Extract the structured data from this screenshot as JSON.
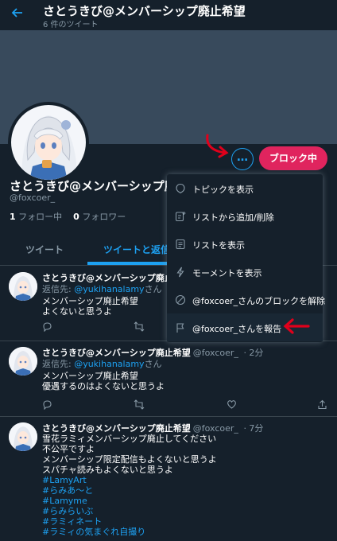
{
  "header": {
    "title": "さとうきび@メンバーシップ廃止希望",
    "subtitle": "6 件のツイート"
  },
  "profile": {
    "name": "さとうきび@メンバーシップ廃止希望",
    "handle": "@foxcoer_",
    "following_count": "1",
    "following_label": "フォロー中",
    "followers_count": "0",
    "followers_label": "フォロワー",
    "blocked_button": "ブロック中",
    "more_button": "…"
  },
  "tabs": [
    "ツイート",
    "ツイートと返信"
  ],
  "menu": [
    {
      "label": "トピックを表示",
      "icon": "topic-icon"
    },
    {
      "label": "リストから追加/削除",
      "icon": "list-add-icon"
    },
    {
      "label": "リストを表示",
      "icon": "list-icon"
    },
    {
      "label": "モーメントを表示",
      "icon": "moment-icon"
    },
    {
      "label": "@foxcoer_さんのブロックを解除",
      "icon": "unblock-icon"
    },
    {
      "label": "@foxcoer_さんを報告",
      "icon": "flag-icon"
    }
  ],
  "tweets": [
    {
      "name": "さとうきび@メンバーシップ廃止",
      "handle": "",
      "time": "",
      "reply_prefix": "返信先: ",
      "reply_to": "@yukihanalamy",
      "reply_suffix": "さん",
      "lines": [
        "メンバーシップ廃止希望",
        "よくないと思うよ"
      ]
    },
    {
      "name": "さとうきび@メンバーシップ廃止希望",
      "handle": "@foxcoer_",
      "time": "· 2分",
      "reply_prefix": "返信先: ",
      "reply_to": "@yukihanalamy",
      "reply_suffix": "さん",
      "lines": [
        "メンバーシップ廃止希望",
        "優遇するのはよくないと思うよ"
      ]
    },
    {
      "name": "さとうきび@メンバーシップ廃止希望",
      "handle": "@foxcoer_",
      "time": "· 7分",
      "lines": [
        "雪花ラミィメンバーシップ廃止してください",
        "不公平ですよ",
        "メンバーシップ限定配信もよくないと思うよ",
        "スパチャ読みもよくないと思うよ"
      ],
      "hashtags": [
        "#LamyArt",
        "#らみあ～と",
        "#Lamyme",
        "#らみらいぶ",
        "#ラミィネート",
        "#ラミィの気まぐれ自撮り"
      ]
    }
  ],
  "colors": {
    "accent": "#1da1f2",
    "block": "#e0245e",
    "annotation": "#e0001b"
  }
}
